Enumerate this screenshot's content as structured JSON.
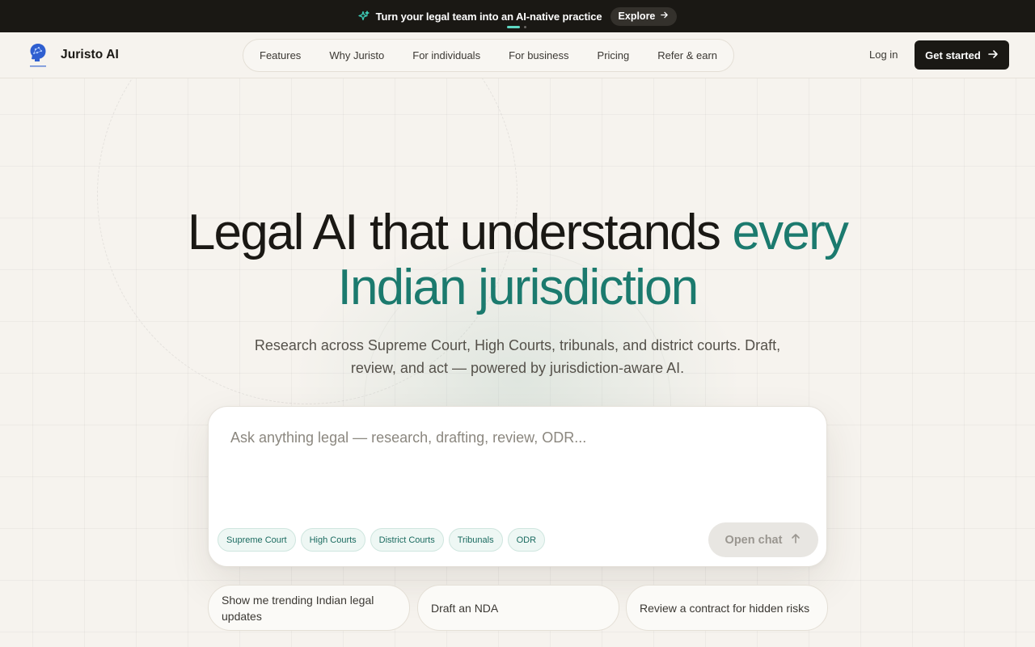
{
  "announcement": {
    "text": "Turn your legal team into an AI-native practice",
    "cta_label": "Explore"
  },
  "brand": {
    "name": "Juristo AI"
  },
  "nav": {
    "items": [
      {
        "label": "Features"
      },
      {
        "label": "Why Juristo"
      },
      {
        "label": "For individuals"
      },
      {
        "label": "For business"
      },
      {
        "label": "Pricing"
      },
      {
        "label": "Refer & earn"
      }
    ],
    "login_label": "Log in",
    "cta_label": "Get started"
  },
  "hero": {
    "title_part1": "Legal AI that understands ",
    "title_accent_1": "every",
    "title_accent_2": "Indian jurisdiction",
    "subtitle": "Research across Supreme Court, High Courts, tribunals, and district courts. Draft, review, and act — powered by jurisdiction-aware AI."
  },
  "prompt_box": {
    "placeholder": "Ask anything legal — research, drafting, review, ODR...",
    "value": "",
    "chips": [
      "Supreme Court",
      "High Courts",
      "District Courts",
      "Tribunals",
      "ODR"
    ],
    "submit_label": "Open chat"
  },
  "suggestions": [
    "Show me trending Indian legal updates",
    "Draft an NDA",
    "Review a contract for hidden risks"
  ],
  "colors": {
    "accent": "#1b7a6e",
    "dark": "#1a1814",
    "background": "#f6f3ee"
  }
}
